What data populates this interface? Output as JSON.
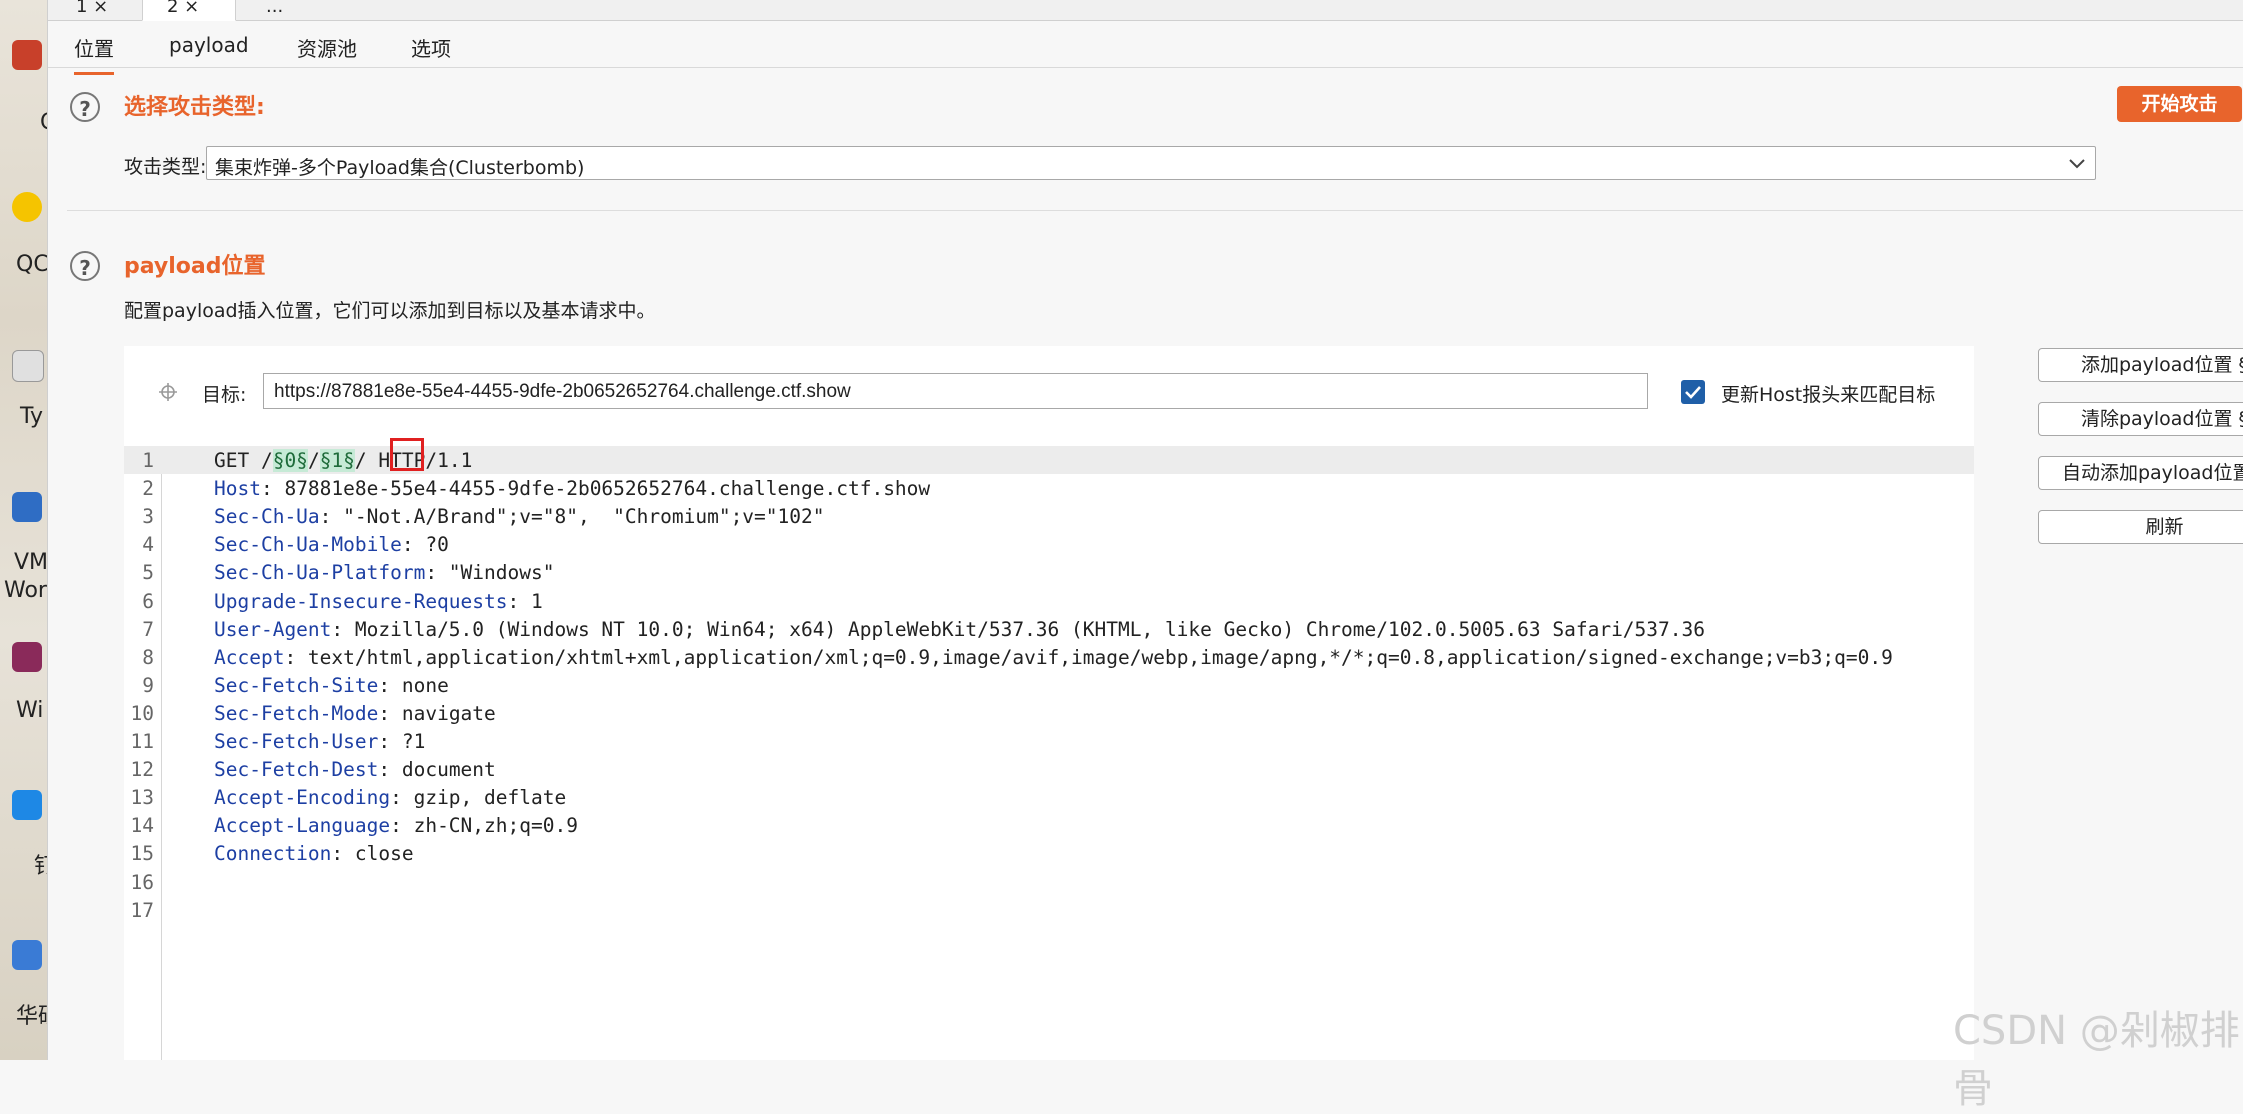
{
  "desktop": {
    "labels": [
      "C",
      "QC",
      "Ty",
      "VM",
      "Wor",
      "Wi",
      "钉",
      "华硕"
    ]
  },
  "attack_tabs": [
    {
      "label": "1 ×"
    },
    {
      "label": "2 ×"
    },
    {
      "label": "..."
    }
  ],
  "sub_tabs": [
    {
      "label": "位置"
    },
    {
      "label": "payload"
    },
    {
      "label": "资源池"
    },
    {
      "label": "选项"
    }
  ],
  "attack_type_section": {
    "title": "选择攻击类型:",
    "start_button": "开始攻击",
    "type_label": "攻击类型:",
    "type_value": "集束炸弹-多个Payload集合(Clusterbomb)"
  },
  "payload_section": {
    "title": "payload位置",
    "description": "配置payload插入位置，它们可以添加到目标以及基本请求中。",
    "target_label": "目标:",
    "target_value": "https://87881e8e-55e4-4455-9dfe-2b0652652764.challenge.ctf.show",
    "update_host_label": "更新Host报头来匹配目标",
    "update_host_checked": true
  },
  "side_buttons": {
    "add": "添加payload位置 §",
    "clear": "清除payload位置 §",
    "auto": "自动添加payload位置 §",
    "refresh": "刷新"
  },
  "request": {
    "line1": {
      "num": "1",
      "prefix": "GET /",
      "marker0": "§0§",
      "sep": "/",
      "marker1": "§1§",
      "slash": "/",
      "suffix": " HTTP/1.1"
    },
    "headers": [
      {
        "num": "2",
        "key": "Host",
        "value": ": 87881e8e-55e4-4455-9dfe-2b0652652764.challenge.ctf.show"
      },
      {
        "num": "3",
        "key": "Sec-Ch-Ua",
        "value": ": \"-Not.A/Brand\";v=\"8\",  \"Chromium\";v=\"102\""
      },
      {
        "num": "4",
        "key": "Sec-Ch-Ua-Mobile",
        "value": ": ?0"
      },
      {
        "num": "5",
        "key": "Sec-Ch-Ua-Platform",
        "value": ": \"Windows\""
      },
      {
        "num": "6",
        "key": "Upgrade-Insecure-Requests",
        "value": ": 1"
      },
      {
        "num": "7",
        "key": "User-Agent",
        "value": ": Mozilla/5.0 (Windows NT 10.0; Win64; x64) AppleWebKit/537.36 (KHTML, like Gecko) Chrome/102.0.5005.63 Safari/537.36"
      },
      {
        "num": "8",
        "key": "Accept",
        "value": ": text/html,application/xhtml+xml,application/xml;q=0.9,image/avif,image/webp,image/apng,*/*;q=0.8,application/signed-exchange;v=b3;q=0.9"
      },
      {
        "num": "9",
        "key": "Sec-Fetch-Site",
        "value": ": none"
      },
      {
        "num": "10",
        "key": "Sec-Fetch-Mode",
        "value": ": navigate"
      },
      {
        "num": "11",
        "key": "Sec-Fetch-User",
        "value": ": ?1"
      },
      {
        "num": "12",
        "key": "Sec-Fetch-Dest",
        "value": ": document"
      },
      {
        "num": "13",
        "key": "Accept-Encoding",
        "value": ": gzip, deflate"
      },
      {
        "num": "14",
        "key": "Accept-Language",
        "value": ": zh-CN,zh;q=0.9"
      },
      {
        "num": "15",
        "key": "Connection",
        "value": ": close"
      }
    ],
    "empty_lines": [
      "16",
      "17"
    ]
  },
  "watermark": "CSDN @剁椒排骨",
  "colors": {
    "accent": "#e8642c",
    "header_key": "#1d3fa3",
    "marker_bg": "#c6ead6",
    "highlight_box": "#e02020"
  }
}
